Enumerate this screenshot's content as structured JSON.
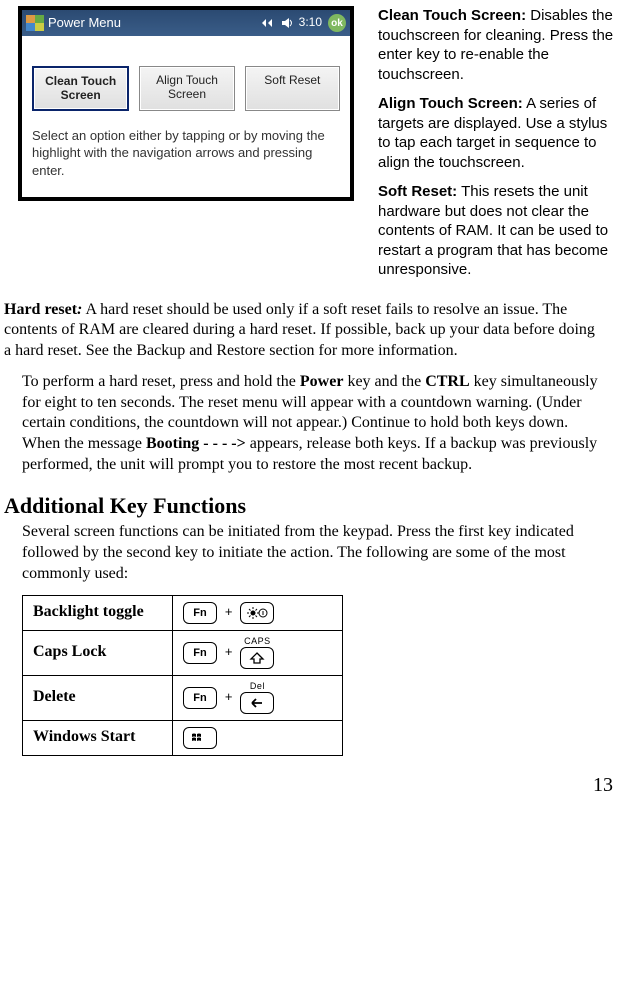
{
  "pda": {
    "title": "Power Menu",
    "time": "3:10",
    "ok": "ok",
    "buttons": {
      "clean": "Clean Touch\nScreen",
      "align": "Align Touch\nScreen",
      "soft": "Soft Reset"
    },
    "hint": "Select an option either by tapping or by moving the highlight with the navigation arrows and pressing enter."
  },
  "side": {
    "clean_label": "Clean Touch Screen:",
    "clean_text": " Disables the touchscreen for cleaning. Press the enter key to re-enable the touchscreen.",
    "align_label": "Align Touch Screen:",
    "align_text": " A series of targets are displayed. Use a stylus to tap each target in sequence to align the touchscreen.",
    "soft_label": "Soft Reset:",
    "soft_text": " This resets the unit hardware but does not clear the contents of RAM. It can be used to restart a program that has become unresponsive."
  },
  "hard": {
    "label": "Hard reset",
    "colon": ":",
    "text1": " A hard reset should be used only if a soft reset fails to resolve an issue. The contents of RAM are cleared during a hard reset. If possible, back up your data before doing a hard reset. See the Backup and Restore section for more information.",
    "p2a": "To perform a hard reset, press and hold the ",
    "power": "Power",
    "p2b": " key and the ",
    "ctrl": "CTRL",
    "p2c": " key simultaneously for eight to ten seconds. The reset menu will appear with a countdown warning. (Under certain conditions, the countdown will not appear.) Continue to hold both keys down. When the message ",
    "booting": "Booting - - - ->",
    "p2d": " appears, release both keys. If a backup was previously performed, the unit will prompt you to restore the most recent backup."
  },
  "additional": {
    "heading": "Additional Key Functions",
    "intro": "Several screen functions can be initiated from the keypad. Press the first key indicated followed by the second key to initiate the action. The following are some of the most commonly used:"
  },
  "table": {
    "backlight": "Backlight toggle",
    "caps": "Caps Lock",
    "delete": "Delete",
    "windows": "Windows Start",
    "fn": "Fn",
    "caps_over": "CAPS",
    "del_over": "Del",
    "plus": "+"
  },
  "page": "13"
}
